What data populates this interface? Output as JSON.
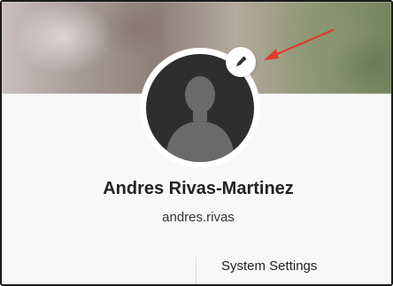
{
  "profile": {
    "full_name": "Andres Rivas-Martinez",
    "username": "andres.rivas"
  },
  "settings": {
    "section_title": "System Settings"
  },
  "icons": {
    "edit": "pencil-icon",
    "avatar": "person-silhouette-icon",
    "annotation": "red-arrow"
  },
  "colors": {
    "annotation_arrow": "#e03a2f",
    "avatar_bg": "#2e2e2e",
    "avatar_silhouette": "#6a6a6a"
  }
}
